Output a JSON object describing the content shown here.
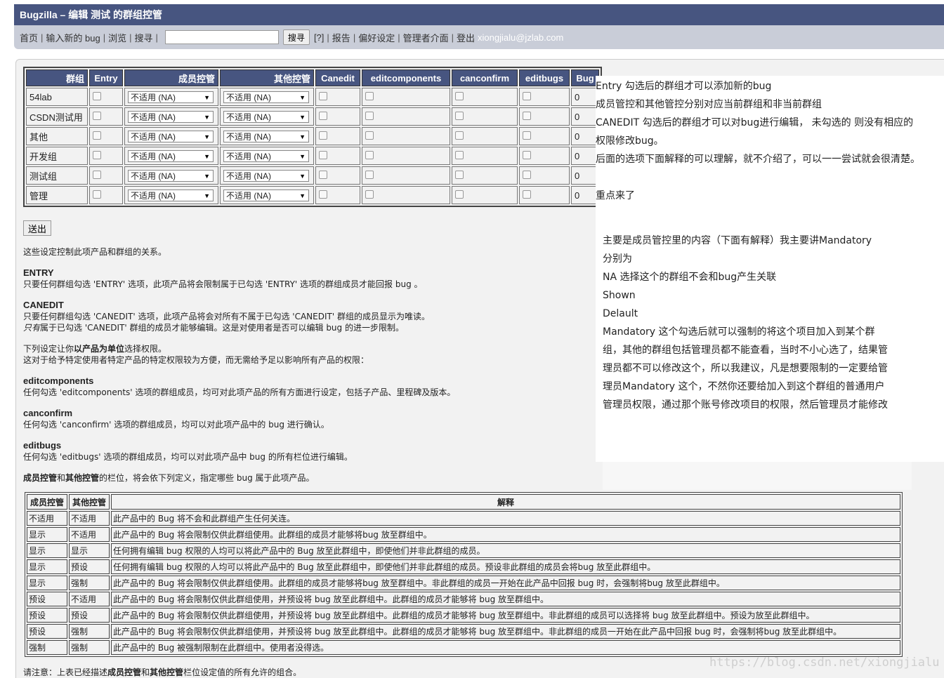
{
  "window": {
    "title": "Bugzilla – 编辑 测试 的群组控管"
  },
  "nav": {
    "items": [
      "首页",
      "输入新的 bug",
      "浏览",
      "搜寻"
    ],
    "search_button": "搜寻",
    "help": "[?]",
    "more": [
      "报告",
      "偏好设定",
      "管理者介面",
      "登出"
    ],
    "user": "xiongjialu@jzlab.com"
  },
  "group_table": {
    "headers": [
      "群组",
      "Entry",
      "成员控管",
      "其他控管",
      "Canedit",
      "editcomponents",
      "canconfirm",
      "editbugs",
      "Bug"
    ],
    "rows": [
      {
        "name": "54lab",
        "member": "不适用 (NA)",
        "other": "不适用 (NA)",
        "bugs": "0"
      },
      {
        "name": "CSDN测试用",
        "member": "不适用 (NA)",
        "other": "不适用 (NA)",
        "bugs": "0"
      },
      {
        "name": "其他",
        "member": "不适用 (NA)",
        "other": "不适用 (NA)",
        "bugs": "0"
      },
      {
        "name": "开发组",
        "member": "不适用 (NA)",
        "other": "不适用 (NA)",
        "bugs": "0"
      },
      {
        "name": "测试组",
        "member": "不适用 (NA)",
        "other": "不适用 (NA)",
        "bugs": "0"
      },
      {
        "name": "管理",
        "member": "不适用 (NA)",
        "other": "不适用 (NA)",
        "bugs": "0"
      }
    ]
  },
  "submit_label": "送出",
  "help": {
    "intro": "这些设定控制此项产品和群组的关系。",
    "entry_term": "ENTRY",
    "entry_desc": "只要任何群组勾选 'ENTRY' 选项，此项产品将会限制属于已勾选 'ENTRY' 选项的群组成员才能回报 bug 。",
    "canedit_term": "CANEDIT",
    "canedit_desc1": "只要任何群组勾选 'CANEDIT' 选项，此项产品将会对所有不属于已勾选 'CANEDIT' 群组的成员显示为唯读。",
    "canedit_only": "只有",
    "canedit_desc2": "属于已勾选 'CANEDIT' 群组的成员才能够编辑。这是对使用者是否可以编辑 bug 的进一步限制。",
    "per_product_a": "下列设定让你",
    "per_product_b": "以产品为单位",
    "per_product_c": "选择权限。",
    "per_product_desc": "这对于给予特定使用者特定产品的特定权限较为方便，而无需给予足以影响所有产品的权限：",
    "editcomponents_term": "editcomponents",
    "editcomponents_desc": "任何勾选 'editcomponents' 选项的群组成员，均可对此项产品的所有方面进行设定，包括子产品、里程碑及版本。",
    "canconfirm_term": "canconfirm",
    "canconfirm_desc": "任何勾选 'canconfirm' 选项的群组成员，均可以对此项产品中的 bug 进行确认。",
    "editbugs_term": "editbugs",
    "editbugs_desc": "任何勾选 'editbugs' 选项的群组成员，均可以对此项产品中 bug 的所有栏位进行编辑。",
    "controls_a": "成员控管",
    "controls_b": "和",
    "controls_c": "其他控管",
    "controls_d": "的栏位，将会依下列定义，指定哪些 bug 属于此项产品。"
  },
  "notes": {
    "top": [
      "Entry 勾选后的群组才可以添加新的bug",
      "成员管控和其他管控分别对应当前群组和非当前群组",
      "CANEDIT 勾选后的群组才可以对bug进行编辑， 未勾选的  则没有相应的",
      "权限修改bug。",
      "后面的选项下面解释的可以理解，就不介绍了，可以一一尝试就会很清楚。",
      "",
      "重点来了"
    ],
    "sub": [
      "主要是成员管控里的内容（下面有解释）我主要讲Mandatory",
      "分别为",
      "NA  选择这个的群组不会和bug产生关联",
      "Shown",
      "Delault",
      "Mandatory 这个勾选后就可以强制的将这个项目加入到某个群",
      "组，其他的群组包括管理员都不能查看，当时不小心选了，结果管",
      "理员都不可以修改这个，所以我建议，凡是想要限制的一定要给管",
      "理员Mandatory 这个，不然你还要给加入到这个群组的普通用户",
      "管理员权限，通过那个账号修改项目的权限，然后管理员才能修改"
    ]
  },
  "explain_table": {
    "headers": [
      "成员控管",
      "其他控管",
      "解释"
    ],
    "rows": [
      [
        "不适用",
        "不适用",
        "此产品中的 Bug 将不会和此群组产生任何关连。"
      ],
      [
        "显示",
        "不适用",
        "此产品中的 Bug 将会限制仅供此群组使用。此群组的成员才能够将bug 放至群组中。"
      ],
      [
        "显示",
        "显示",
        "任何拥有编辑 bug 权限的人均可以将此产品中的 Bug 放至此群组中，即使他们并非此群组的成员。"
      ],
      [
        "显示",
        "预设",
        "任何拥有编辑 bug 权限的人均可以将此产品中的 Bug 放至此群组中，即使他们并非此群组的成员。预设非此群组的成员会将bug 放至此群组中。"
      ],
      [
        "显示",
        "强制",
        "此产品中的 Bug 将会限制仅供此群组使用。此群组的成员才能够将bug 放至群组中。非此群组的成员一开始在此产品中回报 bug 时，会强制将bug 放至此群组中。"
      ],
      [
        "预设",
        "不适用",
        "此产品中的 Bug 将会限制仅供此群组使用，并预设将 bug 放至此群组中。此群组的成员才能够将 bug 放至群组中。"
      ],
      [
        "预设",
        "预设",
        "此产品中的 Bug 将会限制仅供此群组使用，并预设将 bug 放至此群组中。此群组的成员才能够将 bug 放至群组中。非此群组的成员可以选择将 bug 放至此群组中。预设为放至此群组中。"
      ],
      [
        "预设",
        "强制",
        "此产品中的 Bug 将会限制仅供此群组使用，并预设将 bug 放至此群组中。此群组的成员才能够将 bug 放至群组中。非此群组的成员一开始在此产品中回报 bug 时，会强制将bug 放至此群组中。"
      ],
      [
        "强制",
        "强制",
        "此产品中的 Bug 被强制限制在此群组中。使用者没得选。"
      ]
    ]
  },
  "footer": {
    "a": "请注意：上表已经描述",
    "b": "成员控管",
    "c": "和",
    "d": "其他控管",
    "e": "栏位设定值的所有允许的组合。"
  },
  "watermark": "https://blog.csdn.net/xiongjialu"
}
